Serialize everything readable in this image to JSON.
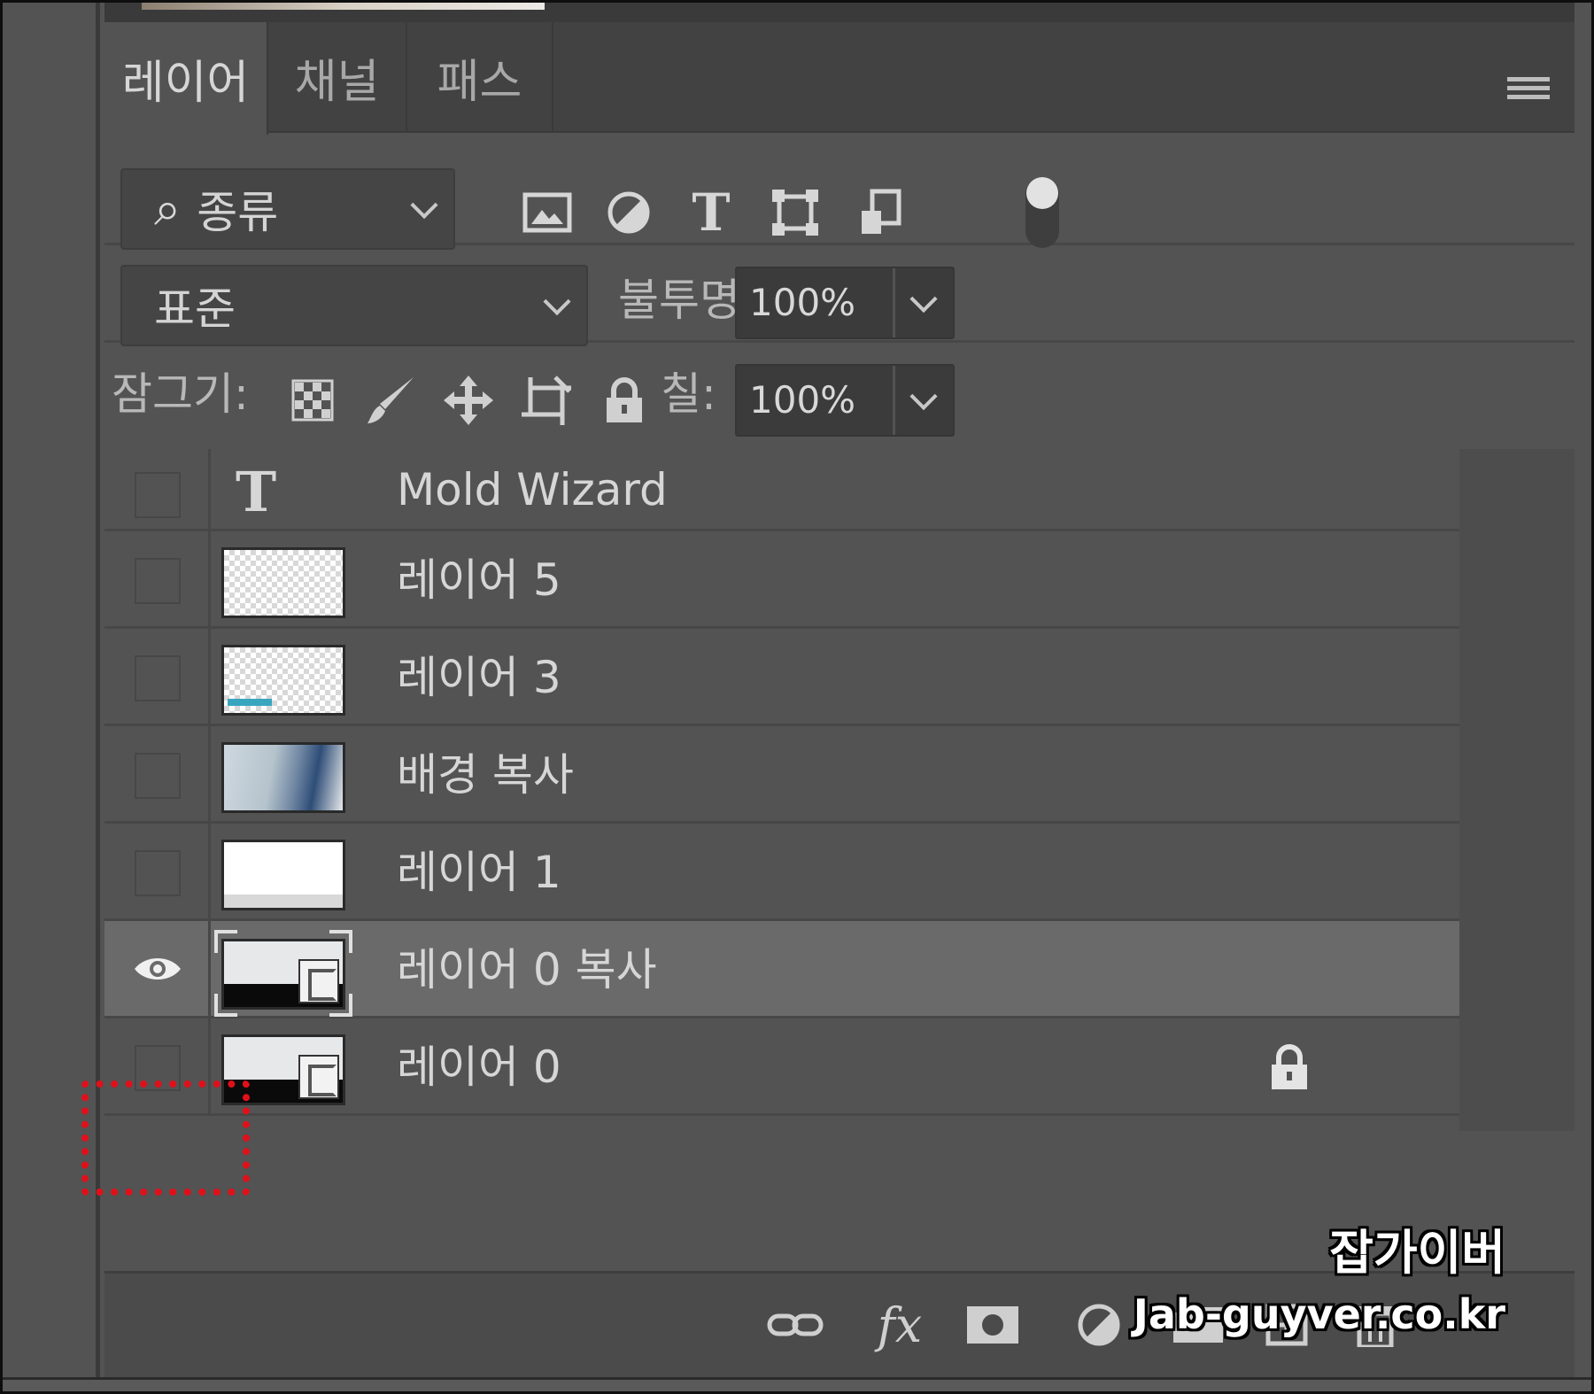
{
  "tabs": [
    {
      "label": "레이어",
      "active": true
    },
    {
      "label": "채널",
      "active": false
    },
    {
      "label": "패스",
      "active": false
    }
  ],
  "filter": {
    "search_glyph": "⌕",
    "kind_label": "종류",
    "icons": [
      "image-filter-icon",
      "adjustment-filter-icon",
      "type-filter-icon",
      "shape-filter-icon",
      "smart-object-filter-icon"
    ]
  },
  "blend": {
    "mode": "표준",
    "opacity_label": "불투명도:",
    "opacity_value": "100%"
  },
  "lock": {
    "label": "잠그기:",
    "fill_label": "칠:",
    "fill_value": "100%"
  },
  "layers": [
    {
      "name": "Mold Wizard",
      "kind": "text",
      "visible": false,
      "locked": false,
      "selected": false
    },
    {
      "name": "레이어 5",
      "kind": "transparent",
      "visible": false,
      "locked": false,
      "selected": false
    },
    {
      "name": "레이어 3",
      "kind": "transparent-teal",
      "visible": false,
      "locked": false,
      "selected": false
    },
    {
      "name": "배경 복사",
      "kind": "photo",
      "visible": false,
      "locked": false,
      "selected": false
    },
    {
      "name": "레이어 1",
      "kind": "white",
      "visible": false,
      "locked": false,
      "selected": false
    },
    {
      "name": "레이어 0 복사",
      "kind": "smart",
      "visible": true,
      "locked": false,
      "selected": true
    },
    {
      "name": "레이어 0",
      "kind": "smart",
      "visible": false,
      "locked": true,
      "selected": false
    }
  ],
  "toolbar": {
    "fx_label": "fx"
  },
  "colors": {
    "panel_bg": "#535353",
    "selected_row": "#6a6a6a",
    "highlight_red": "#e0101a"
  },
  "watermark": {
    "title": "잡가이버",
    "url": "Jab-guyver.co.kr"
  }
}
